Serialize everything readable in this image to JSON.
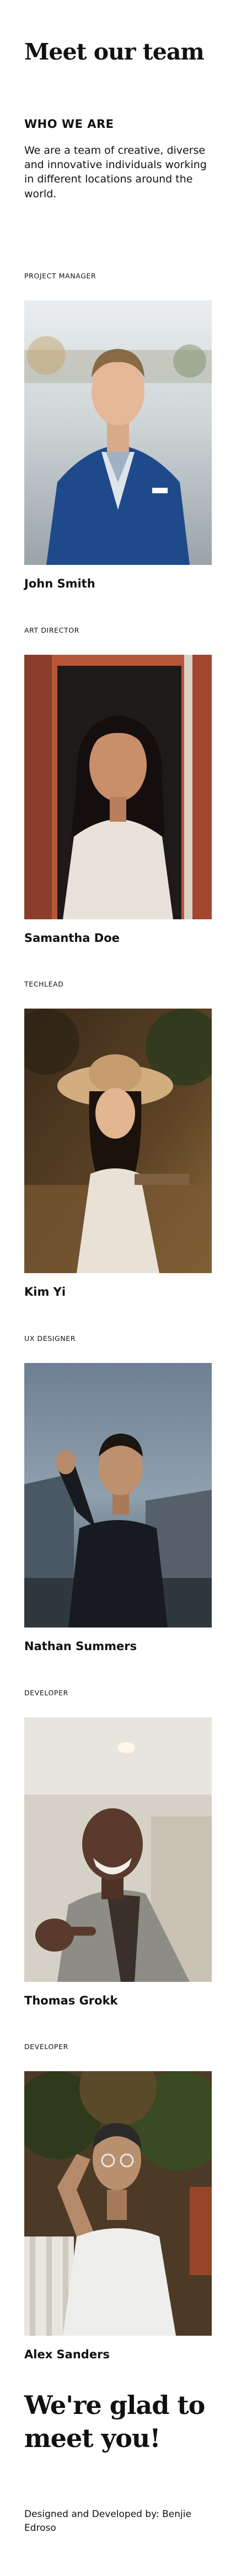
{
  "page_title": "Meet our team",
  "intro": {
    "heading": "WHO WE ARE",
    "text": "We are a team of creative, diverse and innovative individuals working in different locations around the world."
  },
  "members": [
    {
      "role": "PROJECT MANAGER",
      "name": "John Smith"
    },
    {
      "role": "ART DIRECTOR",
      "name": "Samantha Doe"
    },
    {
      "role": "TECHLEAD",
      "name": "Kim Yi"
    },
    {
      "role": "UX DESIGNER",
      "name": "Nathan Summers"
    },
    {
      "role": "DEVELOPER",
      "name": "Thomas Grokk"
    },
    {
      "role": "DEVELOPER",
      "name": "Alex Sanders"
    }
  ],
  "outro": {
    "title": "We're glad to meet you!",
    "credits": "Designed and Developed by: Benjie Edroso"
  }
}
